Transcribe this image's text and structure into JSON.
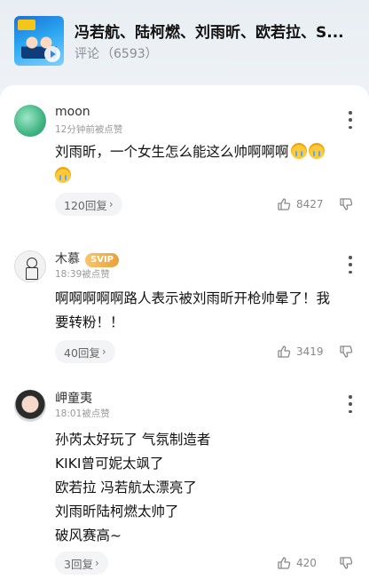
{
  "header": {
    "title": "冯若航、陆柯燃、刘雨昕、欧若拉、S...",
    "comments_label": "评论",
    "comments_count": "（6593）"
  },
  "comments": [
    {
      "username": "moon",
      "time": "12分钟前被点赞",
      "lines": [
        "刘雨昕，一个女生怎么能这么帅啊啊啊"
      ],
      "reply": "120回复",
      "likes": "8427"
    },
    {
      "username": "木慕",
      "badge": "SVIP",
      "time": "18:39被点赞",
      "lines": [
        "啊啊啊啊啊路人表示被刘雨昕开枪帅晕了！我",
        "要转粉！！"
      ],
      "reply": "40回复",
      "likes": "3419"
    },
    {
      "username": "岬童夷",
      "time": "18:01被点赞",
      "lines": [
        "孙芮太好玩了 气氛制造者",
        "KIKI曾可妮太飒了",
        "欧若拉 冯若航太漂亮了",
        "刘雨昕陆柯燃太帅了",
        "破风赛高~"
      ],
      "reply": "3回复",
      "likes": "420"
    }
  ],
  "icons": [
    "play-icon",
    "more-icon",
    "thumb-up-icon",
    "thumb-down-icon",
    "emoji-crying-icon",
    "chevron-right-icon"
  ]
}
